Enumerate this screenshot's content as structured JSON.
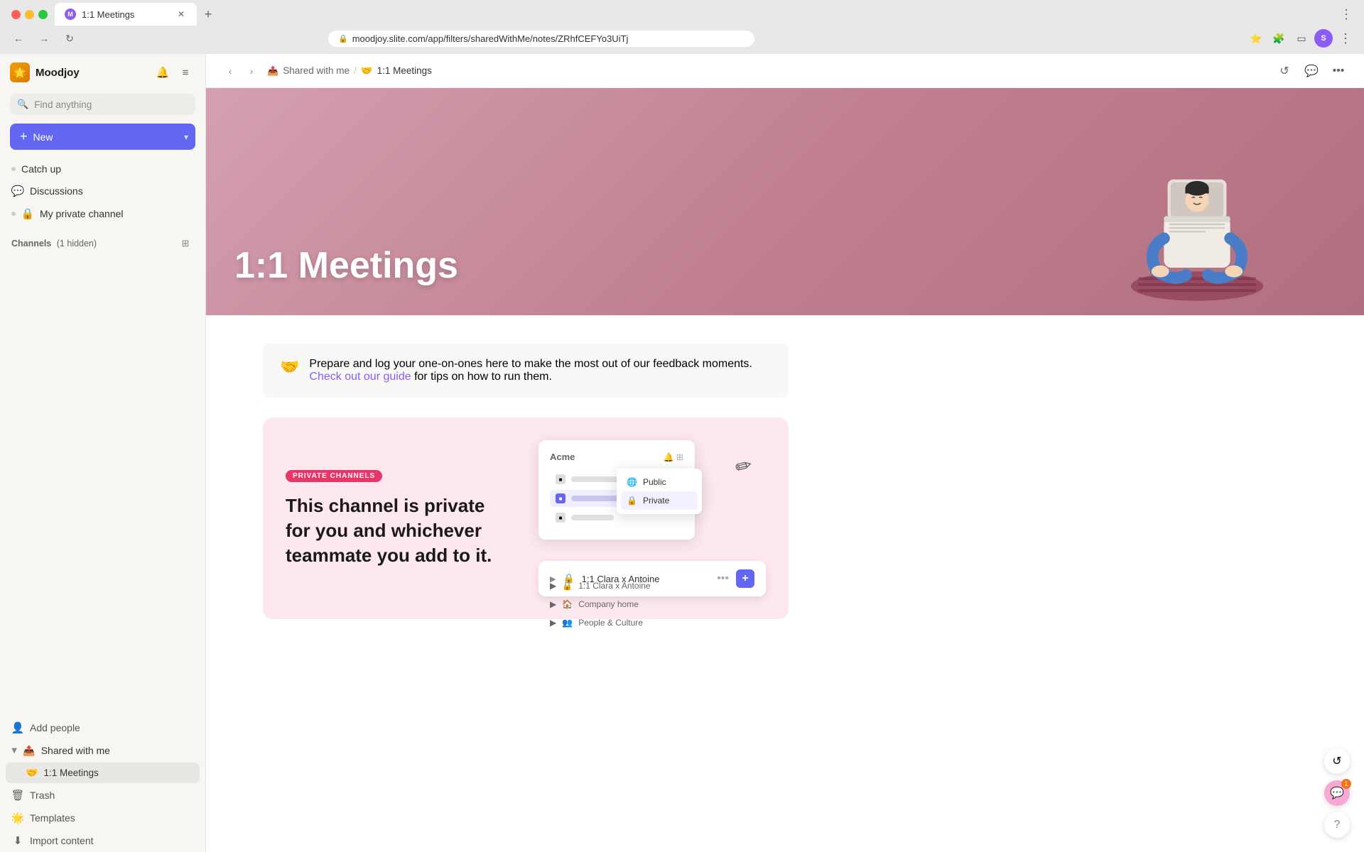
{
  "browser": {
    "tab_title": "1:1 Meetings",
    "url": "moodjoy.slite.com/app/filters/sharedWithMe/notes/ZRhfCEFYo3UiTj",
    "tab_favicon": "M",
    "new_tab_label": "+",
    "back_btn": "←",
    "forward_btn": "→",
    "refresh_btn": "↻",
    "user_initial": "S"
  },
  "sidebar": {
    "workspace_name": "Moodjoy",
    "search_placeholder": "Find anything",
    "new_button_label": "New",
    "nav_items": [
      {
        "id": "catch-up",
        "label": "Catch up",
        "icon": "●"
      },
      {
        "id": "discussions",
        "label": "Discussions",
        "icon": "💬"
      },
      {
        "id": "my-private-channel",
        "label": "My private channel",
        "icon": "🔒"
      }
    ],
    "channels_section": "Channels",
    "channels_hidden": "(1 hidden)",
    "bottom_items": [
      {
        "id": "add-people",
        "label": "Add people",
        "icon": "👤"
      },
      {
        "id": "shared-with-me",
        "label": "Shared with me",
        "icon": "📤"
      },
      {
        "id": "trash",
        "label": "Trash",
        "icon": "🗑"
      },
      {
        "id": "templates",
        "label": "Templates",
        "icon": "🌟"
      },
      {
        "id": "import-content",
        "label": "Import content",
        "icon": "⬇"
      }
    ],
    "nested_items": [
      {
        "id": "1-1-meetings",
        "label": "1:1 Meetings",
        "emoji": "🤝"
      }
    ]
  },
  "breadcrumb": {
    "shared_with_me": "Shared with me",
    "separator": "/",
    "current": "1:1 Meetings",
    "emoji": "🤝"
  },
  "hero": {
    "title": "1:1 Meetings",
    "background_gradient": "linear-gradient(135deg, #c9909a, #b07080)"
  },
  "content": {
    "info_emoji": "🤝",
    "info_text": "Prepare and log your one-on-ones here to make the most out of our feedback moments.",
    "info_link_text": "Check out our guide",
    "info_link_suffix": " for tips on how to run them.",
    "private_card": {
      "badge": "PRIVATE CHANNELS",
      "title": "This channel is private for you and whichever teammate you add to it.",
      "mock_logo": "Acme",
      "dropdown_items": [
        {
          "label": "Public",
          "icon": "🌐"
        },
        {
          "label": "Private",
          "icon": "🔒"
        }
      ],
      "meeting_row_text": "1:1 Clara x Antoine",
      "meeting_row_plus": "+"
    }
  },
  "floating": {
    "sync_icon": "↺",
    "chat_icon": "💬",
    "help_icon": "?",
    "chat_badge": "1"
  }
}
